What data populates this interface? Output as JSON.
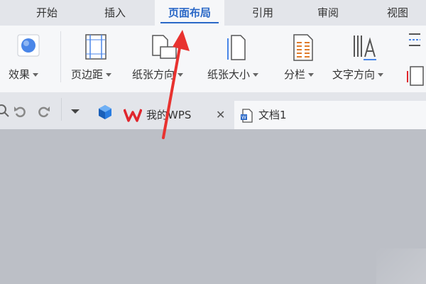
{
  "menu_tabs": [
    {
      "label": "开始",
      "active": false
    },
    {
      "label": "插入",
      "active": false
    },
    {
      "label": "页面布局",
      "active": true
    },
    {
      "label": "引用",
      "active": false
    },
    {
      "label": "审阅",
      "active": false
    },
    {
      "label": "视图",
      "active": false
    }
  ],
  "ribbon": {
    "effects": "效果",
    "margins": "页边距",
    "orientation": "纸张方向",
    "size": "纸张大小",
    "columns": "分栏",
    "text_direction": "文字方向"
  },
  "doc_tabs": {
    "home": "我的WPS",
    "document": "文档1"
  },
  "colors": {
    "accent": "#2a68c7",
    "wps_red": "#e0262d",
    "arrow_red": "#e8322f",
    "workspace": "#bcbfc6"
  },
  "icons": {
    "effects": "effects-icon",
    "margins": "page-margins-icon",
    "orientation": "page-orientation-icon",
    "size": "page-size-icon",
    "columns": "columns-icon",
    "text_direction": "text-direction-icon"
  }
}
